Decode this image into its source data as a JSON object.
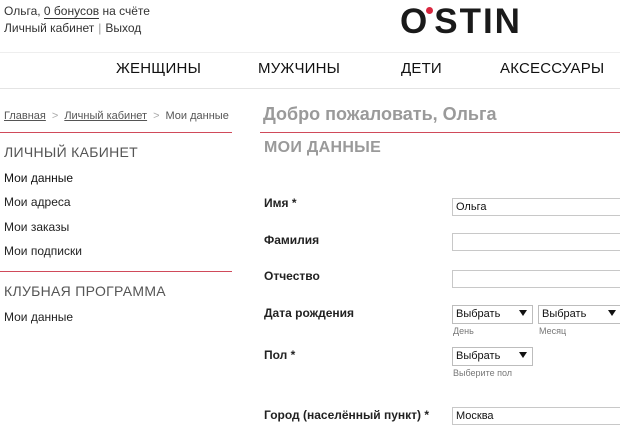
{
  "header": {
    "user_name_prefix": "Ольга, ",
    "bonus_link": "0 бонусов",
    "bonus_suffix": " на счёте",
    "account_link": "Личный кабинет",
    "separator": "|",
    "logout_link": "Выход",
    "logo_left": "O",
    "logo_right": "STIN"
  },
  "nav": {
    "women": "ЖЕНЩИНЫ",
    "men": "МУЖЧИНЫ",
    "kids": "ДЕТИ",
    "accessories": "АКСЕССУАРЫ"
  },
  "breadcrumb": {
    "home": "Главная",
    "account": "Личный кабинет",
    "current": "Мои данные",
    "arrow": ">"
  },
  "sidebar": {
    "account_heading": "ЛИЧНЫЙ КАБИНЕТ",
    "account_items": [
      "Мои данные",
      "Мои адреса",
      "Мои заказы",
      "Мои подписки"
    ],
    "club_heading": "КЛУБНАЯ ПРОГРАММА",
    "club_items": [
      "Мои данные"
    ]
  },
  "main": {
    "welcome": "Добро пожаловать, Ольга",
    "section_title": "МОИ ДАННЫЕ",
    "fields": {
      "first_name_label": "Имя *",
      "first_name_value": "Ольга",
      "last_name_label": "Фамилия",
      "last_name_value": "",
      "patronymic_label": "Отчество",
      "patronymic_value": "",
      "birth_label": "Дата рождения",
      "day_select": "Выбрать",
      "day_hint": "День",
      "month_select": "Выбрать",
      "month_hint": "Месяц",
      "gender_label": "Пол *",
      "gender_select": "Выбрать",
      "gender_hint": "Выберите пол",
      "city_label": "Город (населённый пункт) *",
      "city_value": "Москва"
    }
  },
  "colors": {
    "accent_red": "#d04a5a",
    "logo_dot": "#d9263f",
    "muted_heading": "#9a9a9a"
  }
}
